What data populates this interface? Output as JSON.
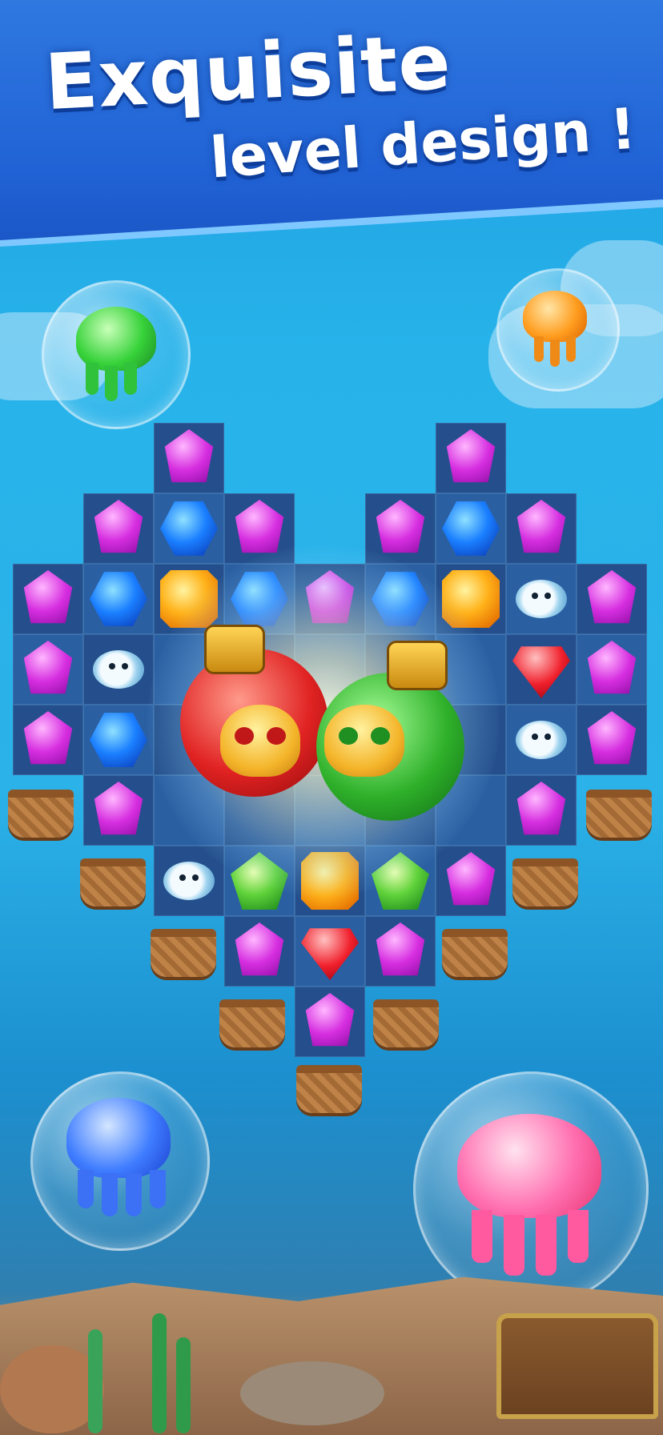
{
  "banner": {
    "title_line1": "Exquisite",
    "title_line2": "level design !"
  },
  "colors": {
    "banner": "#2163d6",
    "water": "#27b3ea",
    "board": "#2a5fa2"
  },
  "pieces": {
    "purple": "purple-gem",
    "blue": "blue-gem",
    "orange": "orange-gem",
    "red": "red-gem",
    "green": "green-gem",
    "fish": "pufferfish",
    "basket": "basket",
    "bomb": "skull-bomb",
    "jellyfish": "jellyfish-bubble"
  }
}
